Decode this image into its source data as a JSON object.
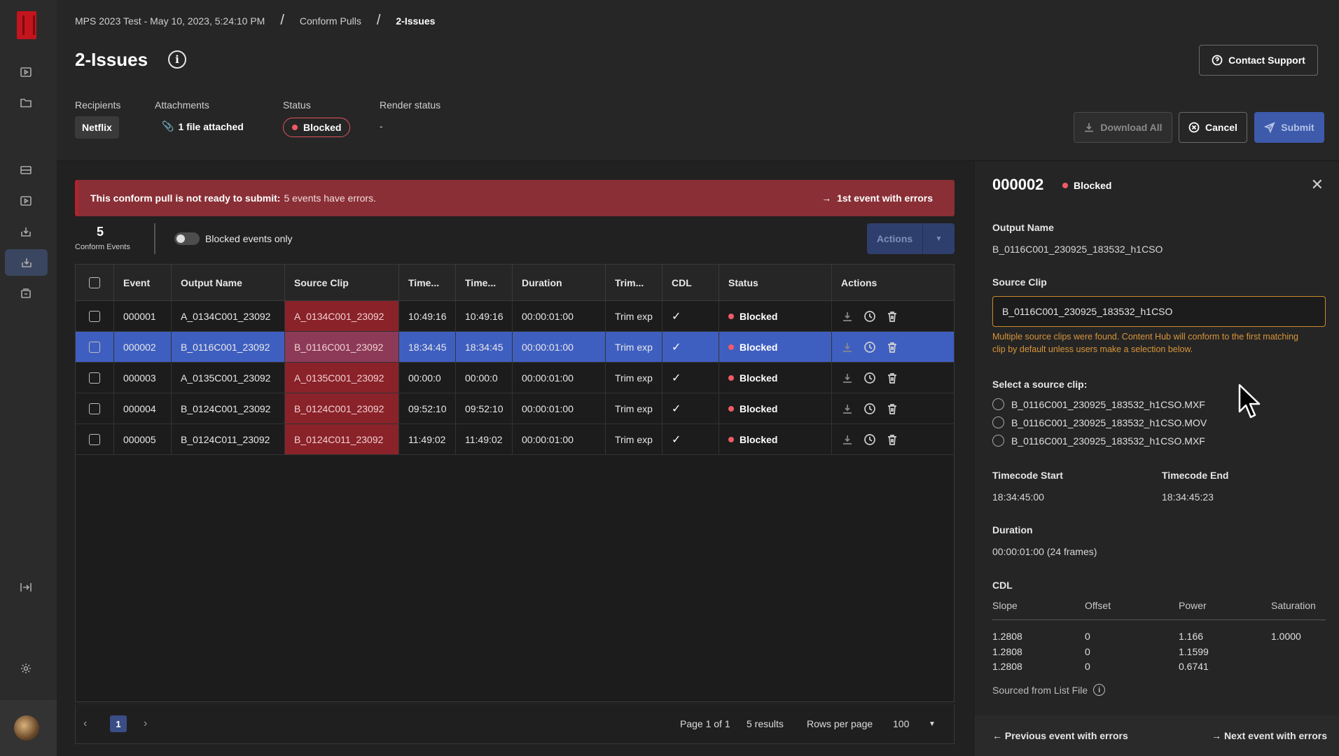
{
  "breadcrumb": [
    "MPS 2023 Test - May 10, 2023, 5:24:10 PM",
    "Conform Pulls",
    "2-Issues"
  ],
  "page_title": "2-Issues",
  "meta": {
    "recipients_label": "Recipients",
    "recipients_value": "Netflix",
    "attachments_label": "Attachments",
    "attachments_value": "1 file attached",
    "status_label": "Status",
    "status_value": "Blocked",
    "render_label": "Render status",
    "render_value": "-"
  },
  "buttons": {
    "contact_support": "Contact Support",
    "download_all": "Download All",
    "cancel": "Cancel",
    "submit": "Submit"
  },
  "alert": {
    "strong": "This conform pull is not ready to submit:",
    "text": "5 events have errors.",
    "link": "1st event with errors"
  },
  "toolbar": {
    "count": "5",
    "count_label": "Conform Events",
    "toggle_label": "Blocked events only",
    "actions_label": "Actions"
  },
  "table": {
    "columns": [
      "Event",
      "Output Name",
      "Source Clip",
      "Time...",
      "Time...",
      "Duration",
      "Trim...",
      "CDL",
      "Status",
      "Actions"
    ],
    "rows": [
      {
        "event": "000001",
        "output": "A_0134C001_23092",
        "source": "A_0134C001_23092",
        "t1": "10:49:16",
        "t2": "10:49:16",
        "duration": "00:00:01:00",
        "trim": "Trim exp",
        "cdl": "✓",
        "status": "Blocked"
      },
      {
        "event": "000002",
        "output": "B_0116C001_23092",
        "source": "B_0116C001_23092",
        "t1": "18:34:45",
        "t2": "18:34:45",
        "duration": "00:00:01:00",
        "trim": "Trim exp",
        "cdl": "✓",
        "status": "Blocked"
      },
      {
        "event": "000003",
        "output": "A_0135C001_23092",
        "source": "A_0135C001_23092",
        "t1": "00:00:0",
        "t2": "00:00:0",
        "duration": "00:00:01:00",
        "trim": "Trim exp",
        "cdl": "✓",
        "status": "Blocked"
      },
      {
        "event": "000004",
        "output": "B_0124C001_23092",
        "source": "B_0124C001_23092",
        "t1": "09:52:10",
        "t2": "09:52:10",
        "duration": "00:00:01:00",
        "trim": "Trim exp",
        "cdl": "✓",
        "status": "Blocked"
      },
      {
        "event": "000005",
        "output": "B_0124C011_23092",
        "source": "B_0124C011_23092",
        "t1": "11:49:02",
        "t2": "11:49:02",
        "duration": "00:00:01:00",
        "trim": "Trim exp",
        "cdl": "✓",
        "status": "Blocked"
      }
    ]
  },
  "pager": {
    "current_page": "1",
    "page_text": "Page 1 of 1",
    "results": "5 results",
    "rows_per_page_label": "Rows per page",
    "rows_per_page": "100"
  },
  "panel": {
    "id": "000002",
    "status": "Blocked",
    "output_name_label": "Output Name",
    "output_name": "B_0116C001_230925_183532_h1CSO",
    "source_clip_label": "Source Clip",
    "source_clip": "B_0116C001_230925_183532_h1CSO",
    "warning": "Multiple source clips were found. Content Hub will conform to the first matching clip by default unless users make a selection below.",
    "select_label": "Select a source clip:",
    "options": [
      "B_0116C001_230925_183532_h1CSO.MXF",
      "B_0116C001_230925_183532_h1CSO.MOV",
      "B_0116C001_230925_183532_h1CSO.MXF"
    ],
    "tc_start_label": "Timecode Start",
    "tc_start": "18:34:45:00",
    "tc_end_label": "Timecode End",
    "tc_end": "18:34:45:23",
    "duration_label": "Duration",
    "duration": "00:00:01:00 (24 frames)",
    "cdl_label": "CDL",
    "cdl_headers": [
      "Slope",
      "Offset",
      "Power",
      "Saturation"
    ],
    "cdl_rows": [
      [
        "1.2808",
        "0",
        "1.166",
        "1.0000"
      ],
      [
        "1.2808",
        "0",
        "1.1599",
        ""
      ],
      [
        "1.2808",
        "0",
        "0.6741",
        ""
      ]
    ],
    "sourced": "Sourced from List File",
    "prev": "Previous event with errors",
    "next": "Next event with errors"
  },
  "colors": {
    "accent": "#3d5aab",
    "error": "#8a2229",
    "status_dot": "#ef5b67",
    "warning": "#d8953a"
  }
}
